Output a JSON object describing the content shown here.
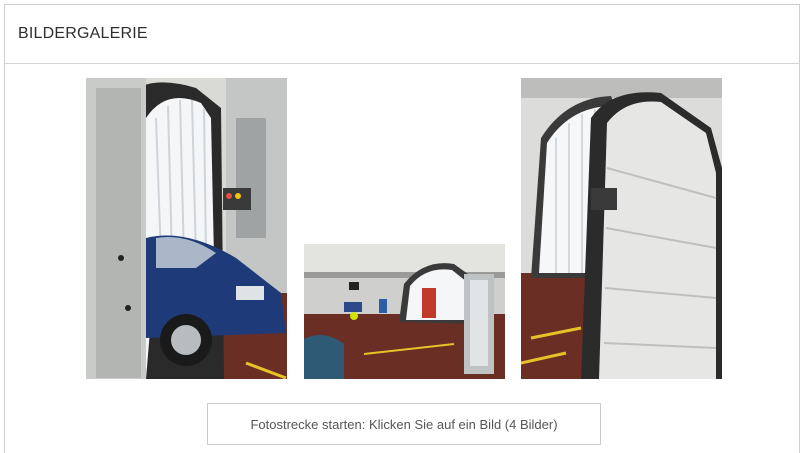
{
  "gallery": {
    "title": "BILDERGALERIE",
    "start_label": "Fotostrecke starten: Klicken Sie auf ein Bild (4 Bilder)"
  },
  "colors": {
    "border": "#cfcfcf",
    "floor": "#6b2e24",
    "arch": "#e8ecef",
    "car_blue": "#1f3a78"
  }
}
